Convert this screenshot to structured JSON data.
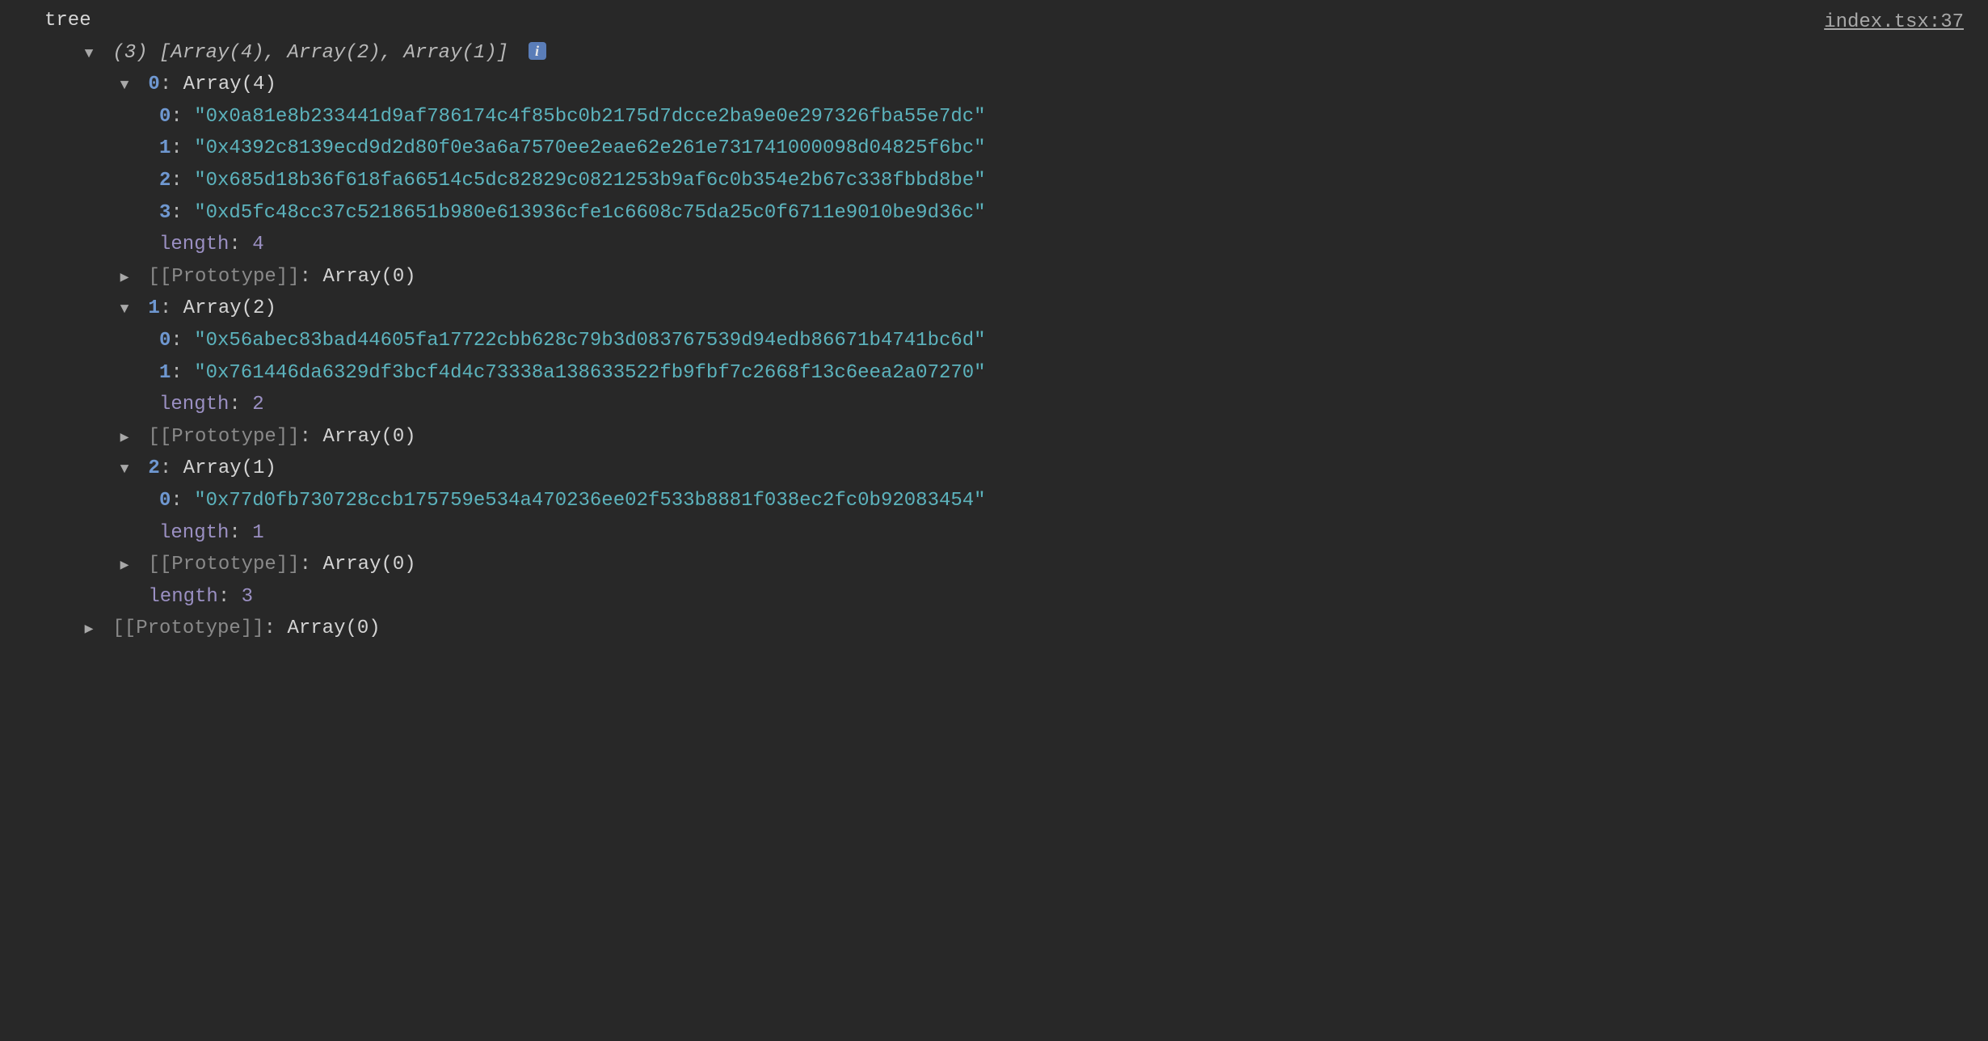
{
  "source_link": "index.tsx:37",
  "label": "tree",
  "summary": "(3) [Array(4), Array(2), Array(1)]",
  "outer_length_key": "length",
  "outer_length_value": "3",
  "outer_proto_key": "[[Prototype]]",
  "outer_proto_value": "Array(0)",
  "arrays": [
    {
      "index": "0",
      "header": "Array(4)",
      "items": [
        {
          "k": "0",
          "v": "\"0x0a81e8b233441d9af786174c4f85bc0b2175d7dcce2ba9e0e297326fba55e7dc\""
        },
        {
          "k": "1",
          "v": "\"0x4392c8139ecd9d2d80f0e3a6a7570ee2eae62e261e731741000098d04825f6bc\""
        },
        {
          "k": "2",
          "v": "\"0x685d18b36f618fa66514c5dc82829c0821253b9af6c0b354e2b67c338fbbd8be\""
        },
        {
          "k": "3",
          "v": "\"0xd5fc48cc37c5218651b980e613936cfe1c6608c75da25c0f6711e9010be9d36c\""
        }
      ],
      "length_key": "length",
      "length_value": "4",
      "proto_key": "[[Prototype]]",
      "proto_value": "Array(0)"
    },
    {
      "index": "1",
      "header": "Array(2)",
      "items": [
        {
          "k": "0",
          "v": "\"0x56abec83bad44605fa17722cbb628c79b3d083767539d94edb86671b4741bc6d\""
        },
        {
          "k": "1",
          "v": "\"0x761446da6329df3bcf4d4c73338a138633522fb9fbf7c2668f13c6eea2a07270\""
        }
      ],
      "length_key": "length",
      "length_value": "2",
      "proto_key": "[[Prototype]]",
      "proto_value": "Array(0)"
    },
    {
      "index": "2",
      "header": "Array(1)",
      "items": [
        {
          "k": "0",
          "v": "\"0x77d0fb730728ccb175759e534a470236ee02f533b8881f038ec2fc0b92083454\""
        }
      ],
      "length_key": "length",
      "length_value": "1",
      "proto_key": "[[Prototype]]",
      "proto_value": "Array(0)"
    }
  ]
}
